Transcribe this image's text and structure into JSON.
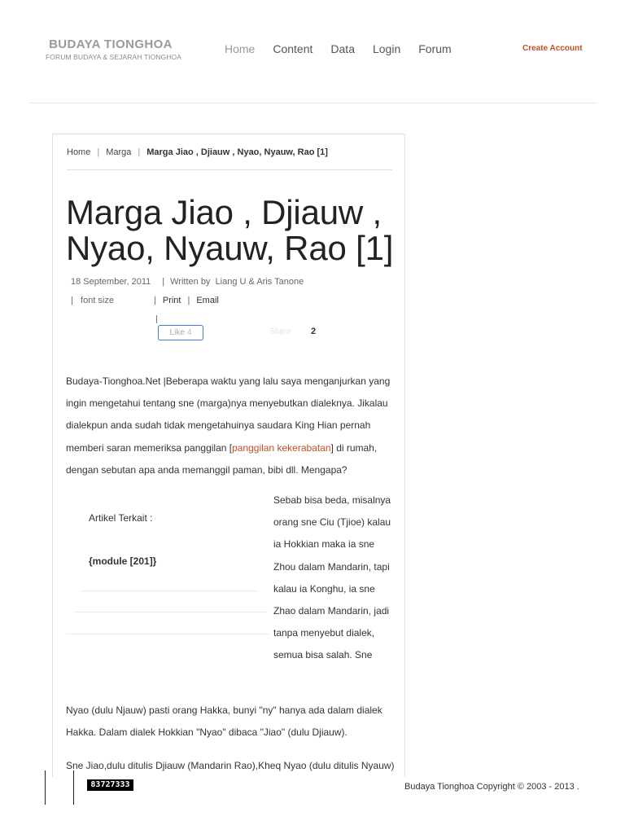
{
  "brand": {
    "title": "BUDAYA TIONGHOA",
    "subtitle": "FORUM BUDAYA & SEJARAH TIONGHOA"
  },
  "nav": {
    "items": [
      "Home",
      "Content",
      "Data",
      "Login",
      "Forum"
    ],
    "active": "Home",
    "create_account": "Create Account"
  },
  "breadcrumb": {
    "home": "Home",
    "section": "Marga",
    "separator": "|",
    "current": "Marga Jiao , Djiauw , Nyao, Nyauw, Rao [1]"
  },
  "article": {
    "title": "Marga Jiao , Djiauw , Nyao, Nyauw, Rao [1]",
    "date": "18 September, 2011",
    "written_by_label": "Written by",
    "authors": "Liang U & Aris Tanone",
    "font_size_label": "font size",
    "print_label": "Print",
    "email_label": "Email",
    "like_label": "Like",
    "like_count": "4",
    "share_label": "Share",
    "share_count": "2",
    "para1_before_link": "Budaya-Tionghoa.Net |Beberapa waktu yang lalu saya menganjurkan yang ingin mengetahui tentang sne (marga)nya menyebutkan dialeknya. Jikalau dialekpun anda sudah tidak mengetahuinya  saudara King Hian pernah memberi saran memeriksa panggilan [",
    "para1_link": "panggilan kekerabatan",
    "para1_after_link": "] di rumah, dengan sebutan apa anda memanggil paman, bibi dll. Mengapa?",
    "related_label": "Artikel Terkait :",
    "module_tag": "{module [201]}",
    "para2_float": "Sebab bisa beda, misalnya orang sne Ciu (Tjioe) kalau ia Hokkian maka ia sne Zhou dalam Mandarin, tapi kalau ia Konghu, ia sne Zhao dalam Mandarin, jadi tanpa menyebut dialek, semua bisa salah. Sne",
    "para2_rest": "Nyao (dulu Njauw)  pasti orang Hakka, bunyi \"ny\" hanya ada dalam dialek Hakka. Dalam dialek Hokkian \"Nyao\" dibaca \"Jiao\" (dulu Djiauw).",
    "para3": "Sne Jiao,dulu ditulis Djiauw (Mandarin Rao),Kheq Nyao (dulu ditulis Nyauw) pertama berkembang di Raoyang, sebuah tempat yang pada"
  },
  "footer": {
    "counter": "83727333",
    "copyright": "Budaya Tionghoa Copyright © 2003 - 2013 ."
  },
  "colors": {
    "accent": "#c0502b",
    "like_border": "#4a77c4"
  }
}
